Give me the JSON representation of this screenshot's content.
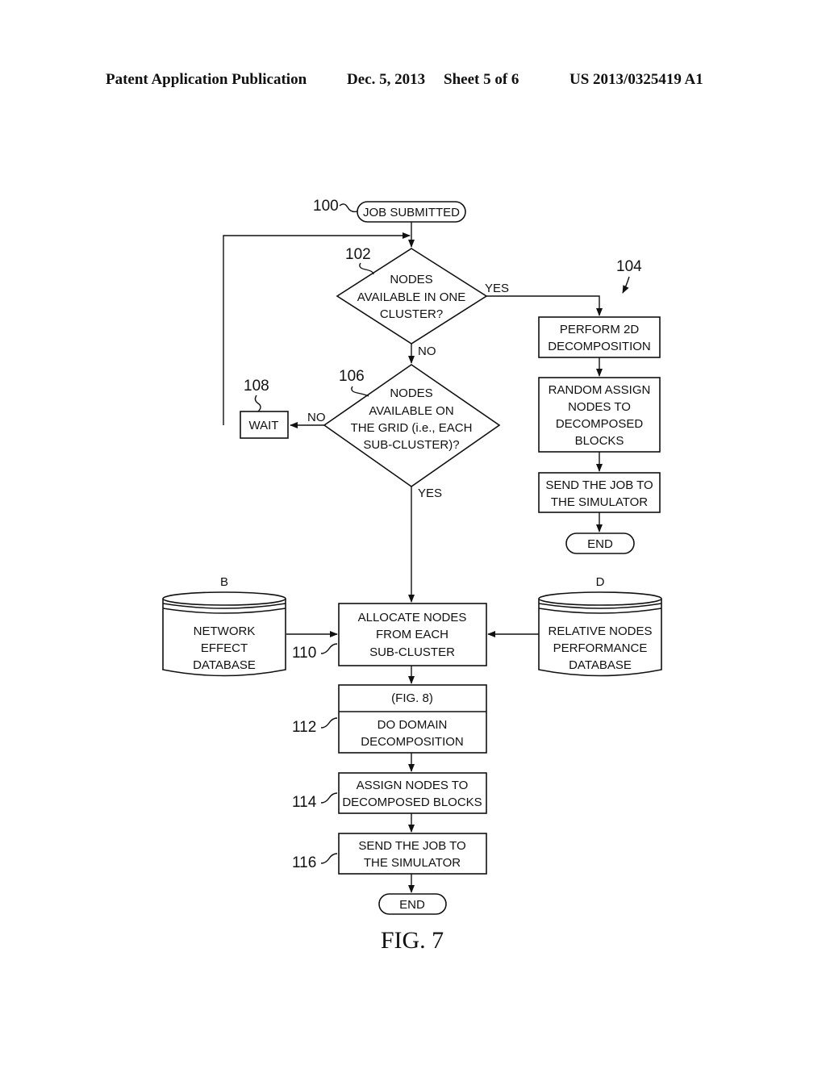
{
  "header": {
    "publication": "Patent Application Publication",
    "date": "Dec. 5, 2013",
    "sheet": "Sheet 5 of 6",
    "number": "US 2013/0325419 A1"
  },
  "figure_label": "FIG. 7",
  "nodes": {
    "start": {
      "ref": "100",
      "lines": [
        "JOB SUBMITTED"
      ]
    },
    "decision_one_cluster": {
      "ref": "102",
      "lines": [
        "NODES",
        "AVAILABLE IN ONE",
        "CLUSTER?"
      ]
    },
    "branch_104": {
      "ref": "104"
    },
    "perform_2d": {
      "lines": [
        "PERFORM 2D",
        "DECOMPOSITION"
      ]
    },
    "random_assign": {
      "lines": [
        "RANDOM ASSIGN",
        "NODES TO",
        "DECOMPOSED",
        "BLOCKS"
      ]
    },
    "send_job_right": {
      "lines": [
        "SEND THE JOB TO",
        "THE SIMULATOR"
      ]
    },
    "end_right": {
      "lines": [
        "END"
      ]
    },
    "decision_grid": {
      "ref": "106",
      "lines": [
        "NODES",
        "AVAILABLE ON",
        "THE GRID (i.e., EACH",
        "SUB-CLUSTER)?"
      ]
    },
    "wait": {
      "ref": "108",
      "lines": [
        "WAIT"
      ]
    },
    "network_db": {
      "tag": "B",
      "lines": [
        "NETWORK",
        "EFFECT",
        "DATABASE"
      ]
    },
    "relative_db": {
      "tag": "D",
      "lines": [
        "RELATIVE NODES",
        "PERFORMANCE",
        "DATABASE"
      ]
    },
    "allocate": {
      "ref": "110",
      "lines": [
        "ALLOCATE NODES",
        "FROM EACH",
        "SUB-CLUSTER"
      ]
    },
    "domain_decomp": {
      "ref": "112",
      "header": "(FIG. 8)",
      "lines": [
        "DO DOMAIN",
        "DECOMPOSITION"
      ]
    },
    "assign_nodes": {
      "ref": "114",
      "lines": [
        "ASSIGN NODES TO",
        "DECOMPOSED BLOCKS"
      ]
    },
    "send_job": {
      "ref": "116",
      "lines": [
        "SEND THE JOB TO",
        "THE SIMULATOR"
      ]
    },
    "end": {
      "lines": [
        "END"
      ]
    }
  },
  "edge_labels": {
    "yes_102": "YES",
    "no_102": "NO",
    "no_106": "NO",
    "yes_106": "YES"
  }
}
